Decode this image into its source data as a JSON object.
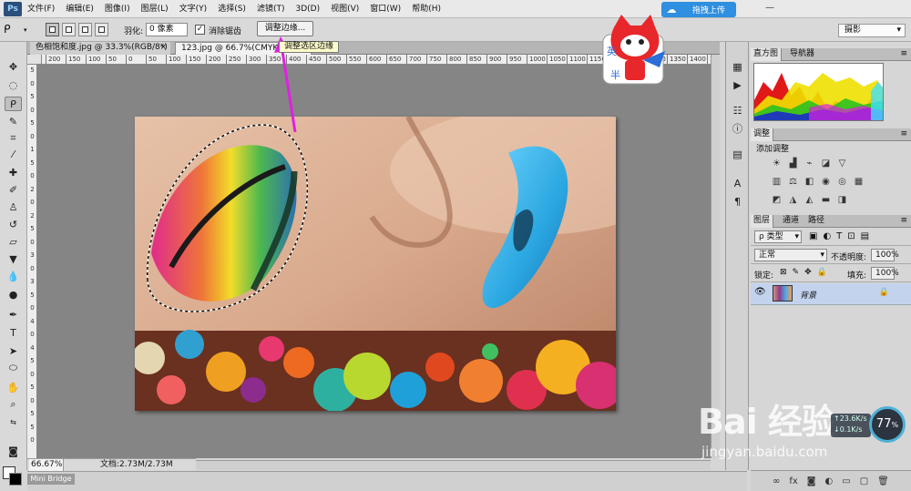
{
  "menu": [
    "文件(F)",
    "编辑(E)",
    "图像(I)",
    "图层(L)",
    "文字(Y)",
    "选择(S)",
    "滤镜(T)",
    "3D(D)",
    "视图(V)",
    "窗口(W)",
    "帮助(H)"
  ],
  "app_logo": "Ps",
  "upload_button": "拖拽上传",
  "minimize": "—",
  "workspace": "摄影",
  "options": {
    "feather_label": "羽化:",
    "feather_value": "0 像素",
    "antialias_label": "消除锯齿",
    "antialias_checked": true,
    "refine_edge_button": "调整边缘...",
    "tooltip": "调整选区边缘"
  },
  "tabs": [
    {
      "label": "色相饱和度.jpg @ 33.3%(RGB/8*)",
      "close": "×"
    },
    {
      "label": "123.jpg @ 66.7%(CMYK/8)",
      "close": "×"
    }
  ],
  "ruler_top": [
    "200",
    "150",
    "100",
    "50",
    "0",
    "50",
    "100",
    "150",
    "200",
    "250",
    "300",
    "350",
    "400",
    "450",
    "500",
    "550",
    "600",
    "650",
    "700",
    "750",
    "800",
    "850",
    "900",
    "950",
    "1000",
    "1050",
    "1100",
    "1150",
    "1200",
    "1250",
    "1300",
    "1350",
    "1400",
    "1450"
  ],
  "ruler_left": [
    "5",
    "0",
    "5",
    "0",
    "5",
    "0",
    "1",
    "5",
    "0",
    "2",
    "0",
    "2",
    "5",
    "0",
    "3",
    "0",
    "3",
    "5",
    "0",
    "4",
    "0",
    "4",
    "5",
    "0",
    "5",
    "0",
    "5",
    "5",
    "0"
  ],
  "status": {
    "zoom": "66.67%",
    "doc": "文档:2.73M/2.73M"
  },
  "mini_bridge": "Mini Bridge",
  "panels": {
    "histogram_tabs": [
      "直方图",
      "导航器"
    ],
    "adjust_tab": "调整",
    "adjust_title": "添加调整",
    "layers_tabs": [
      "图层",
      "通道",
      "路径"
    ],
    "layer_kind": "ρ 类型",
    "blend_mode": "正常",
    "opacity_label": "不透明度:",
    "opacity_value": "100%",
    "lock_label": "锁定:",
    "fill_label": "填充:",
    "fill_value": "100%",
    "layer_name": "背景"
  },
  "mascot_text": [
    "英",
    "半"
  ],
  "watermark": {
    "logo": "Bai 经验",
    "url": "jingyan.baidu.com"
  },
  "speed": {
    "percent": "77",
    "unit": "%",
    "rate_up": "↑23.6K/s",
    "rate_down": "↓0.1K/s"
  },
  "colors": {
    "accent_blue": "#2f8fe0",
    "arrow_magenta": "#e020e0",
    "lips_blue": "#33aee6"
  }
}
